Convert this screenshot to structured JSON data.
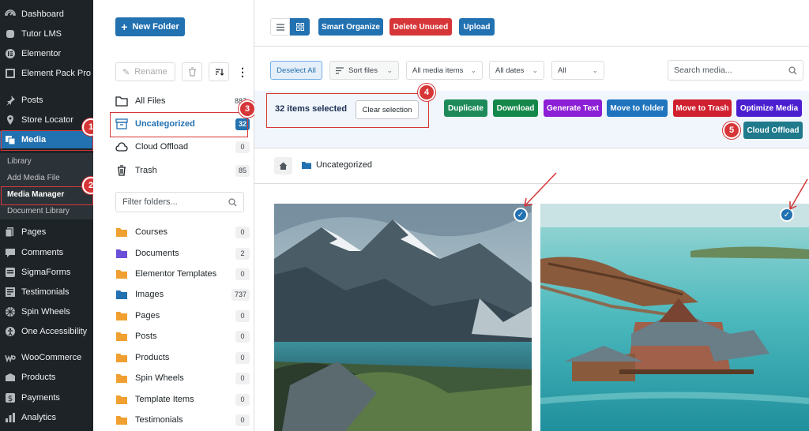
{
  "sidebar": {
    "items": [
      {
        "label": "Dashboard",
        "icon": "dashboard-icon"
      },
      {
        "label": "Tutor LMS",
        "icon": "tutor-icon"
      },
      {
        "label": "Elementor",
        "icon": "elementor-icon"
      },
      {
        "label": "Element Pack Pro",
        "icon": "element-pack-icon"
      },
      {
        "label": "Posts",
        "icon": "pin-icon"
      },
      {
        "label": "Store Locator",
        "icon": "location-icon"
      },
      {
        "label": "Media",
        "icon": "media-icon"
      },
      {
        "label": "Pages",
        "icon": "pages-icon"
      },
      {
        "label": "Comments",
        "icon": "comments-icon"
      },
      {
        "label": "SigmaForms",
        "icon": "forms-icon"
      },
      {
        "label": "Testimonials",
        "icon": "testimonials-icon"
      },
      {
        "label": "Spin Wheels",
        "icon": "wheel-icon"
      },
      {
        "label": "One Accessibility",
        "icon": "accessibility-icon"
      },
      {
        "label": "WooCommerce",
        "icon": "woocommerce-icon"
      },
      {
        "label": "Products",
        "icon": "products-icon"
      },
      {
        "label": "Payments",
        "icon": "payments-icon"
      },
      {
        "label": "Analytics",
        "icon": "analytics-icon"
      }
    ],
    "submenu": [
      "Library",
      "Add Media File",
      "Media Manager",
      "Document Library"
    ]
  },
  "steps": [
    "1",
    "2",
    "3",
    "4",
    "5"
  ],
  "folders": {
    "new_folder": "New Folder",
    "rename": "Rename",
    "system": [
      {
        "label": "All Files",
        "count": "887"
      },
      {
        "label": "Uncategorized",
        "count": "32"
      },
      {
        "label": "Cloud Offload",
        "count": "0"
      },
      {
        "label": "Trash",
        "count": "85"
      }
    ],
    "filter_placeholder": "Filter folders...",
    "list": [
      {
        "label": "Courses",
        "count": "0",
        "color": "#f0a030"
      },
      {
        "label": "Documents",
        "count": "2",
        "color": "#6c4fd8"
      },
      {
        "label": "Elementor Templates",
        "count": "0",
        "color": "#f0a030"
      },
      {
        "label": "Images",
        "count": "737",
        "color": "#2271b1"
      },
      {
        "label": "Pages",
        "count": "0",
        "color": "#f0a030"
      },
      {
        "label": "Posts",
        "count": "0",
        "color": "#f0a030"
      },
      {
        "label": "Products",
        "count": "0",
        "color": "#f0a030"
      },
      {
        "label": "Spin Wheels",
        "count": "0",
        "color": "#f0a030"
      },
      {
        "label": "Template Items",
        "count": "0",
        "color": "#f0a030"
      },
      {
        "label": "Testimonials",
        "count": "0",
        "color": "#f0a030"
      }
    ]
  },
  "toolbar": {
    "smart_organize": "Smart Organize",
    "delete_unused": "Delete Unused",
    "upload": "Upload"
  },
  "filters": {
    "deselect_all": "Deselect All",
    "sort_files": "Sort files",
    "media_items": "All media items",
    "dates": "All dates",
    "all": "All",
    "search_placeholder": "Search media..."
  },
  "selection": {
    "text": "32 items selected",
    "clear": "Clear selection",
    "actions": [
      {
        "label": "Duplicate",
        "color": "#1e8a5a"
      },
      {
        "label": "Download",
        "color": "#14884a"
      },
      {
        "label": "Generate Text",
        "color": "#8c1fd6"
      },
      {
        "label": "Move to folder",
        "color": "#1f74bd"
      },
      {
        "label": "Move to Trash",
        "color": "#d0202f"
      },
      {
        "label": "Optimize Media",
        "color": "#4b1fd0"
      }
    ],
    "cloud_offload": "Cloud Offload"
  },
  "breadcrumb": {
    "folder": "Uncategorized"
  },
  "colors": {
    "accent": "#2271b1",
    "sidebar": "#1d2327",
    "highlight": "#d63638"
  }
}
